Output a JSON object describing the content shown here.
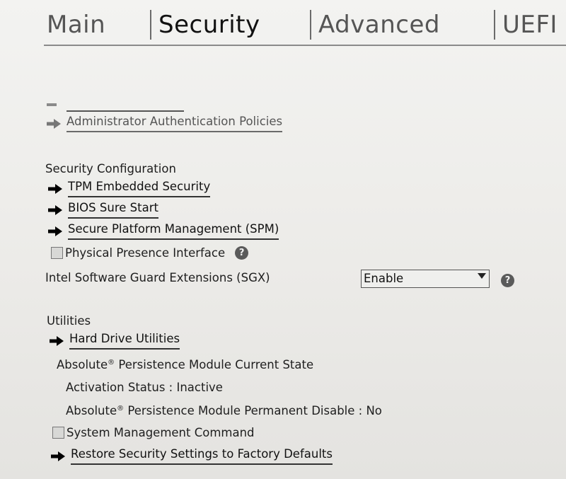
{
  "tabs": [
    {
      "label": "Main",
      "active": false
    },
    {
      "label": "Security",
      "active": true
    },
    {
      "label": "Advanced",
      "active": false
    },
    {
      "label": "UEFI",
      "active": false
    }
  ],
  "links": {
    "admin_auth_policies": "Administrator Authentication Policies",
    "tpm_embedded_security": "TPM Embedded Security",
    "bios_sure_start": "BIOS Sure Start",
    "secure_platform_management": "Secure Platform Management (SPM)",
    "hard_drive_utilities": "Hard Drive Utilities",
    "restore_security_defaults": "Restore Security Settings to Factory Defaults"
  },
  "sections": {
    "security_configuration": "Security Configuration",
    "utilities": "Utilities"
  },
  "physical_presence": {
    "label": "Physical Presence Interface",
    "checked": false
  },
  "sgx": {
    "label": "Intel Software Guard Extensions (SGX)",
    "value": "Enable"
  },
  "absolute": {
    "brand": "Absolute",
    "mark": "®",
    "current_state_suffix": " Persistence Module Current State",
    "activation_status": "Activation Status : Inactive",
    "permanent_disable_suffix": " Persistence Module Permanent Disable : No"
  },
  "system_management_command": {
    "label": "System Management Command",
    "checked": false
  },
  "help_glyph": "?",
  "icons": {
    "arrow": "right-arrow-icon",
    "help": "help-icon",
    "dropdown": "chevron-down-icon"
  },
  "colors": {
    "background": "#eeedea",
    "text": "#1b1b1b",
    "help_icon": "#5a5a5a"
  }
}
